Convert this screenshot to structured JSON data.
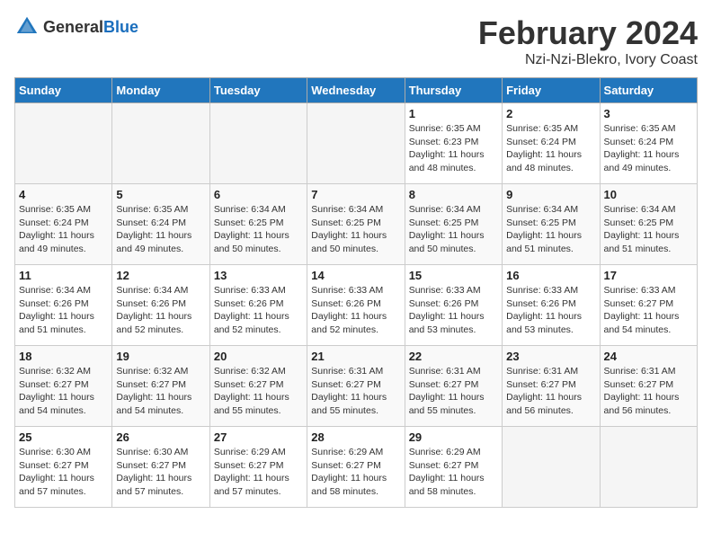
{
  "header": {
    "logo_general": "General",
    "logo_blue": "Blue",
    "month_title": "February 2024",
    "subtitle": "Nzi-Nzi-Blekro, Ivory Coast"
  },
  "days_of_week": [
    "Sunday",
    "Monday",
    "Tuesday",
    "Wednesday",
    "Thursday",
    "Friday",
    "Saturday"
  ],
  "weeks": [
    [
      {
        "day": "",
        "detail": ""
      },
      {
        "day": "",
        "detail": ""
      },
      {
        "day": "",
        "detail": ""
      },
      {
        "day": "",
        "detail": ""
      },
      {
        "day": "1",
        "detail": "Sunrise: 6:35 AM\nSunset: 6:23 PM\nDaylight: 11 hours\nand 48 minutes."
      },
      {
        "day": "2",
        "detail": "Sunrise: 6:35 AM\nSunset: 6:24 PM\nDaylight: 11 hours\nand 48 minutes."
      },
      {
        "day": "3",
        "detail": "Sunrise: 6:35 AM\nSunset: 6:24 PM\nDaylight: 11 hours\nand 49 minutes."
      }
    ],
    [
      {
        "day": "4",
        "detail": "Sunrise: 6:35 AM\nSunset: 6:24 PM\nDaylight: 11 hours\nand 49 minutes."
      },
      {
        "day": "5",
        "detail": "Sunrise: 6:35 AM\nSunset: 6:24 PM\nDaylight: 11 hours\nand 49 minutes."
      },
      {
        "day": "6",
        "detail": "Sunrise: 6:34 AM\nSunset: 6:25 PM\nDaylight: 11 hours\nand 50 minutes."
      },
      {
        "day": "7",
        "detail": "Sunrise: 6:34 AM\nSunset: 6:25 PM\nDaylight: 11 hours\nand 50 minutes."
      },
      {
        "day": "8",
        "detail": "Sunrise: 6:34 AM\nSunset: 6:25 PM\nDaylight: 11 hours\nand 50 minutes."
      },
      {
        "day": "9",
        "detail": "Sunrise: 6:34 AM\nSunset: 6:25 PM\nDaylight: 11 hours\nand 51 minutes."
      },
      {
        "day": "10",
        "detail": "Sunrise: 6:34 AM\nSunset: 6:25 PM\nDaylight: 11 hours\nand 51 minutes."
      }
    ],
    [
      {
        "day": "11",
        "detail": "Sunrise: 6:34 AM\nSunset: 6:26 PM\nDaylight: 11 hours\nand 51 minutes."
      },
      {
        "day": "12",
        "detail": "Sunrise: 6:34 AM\nSunset: 6:26 PM\nDaylight: 11 hours\nand 52 minutes."
      },
      {
        "day": "13",
        "detail": "Sunrise: 6:33 AM\nSunset: 6:26 PM\nDaylight: 11 hours\nand 52 minutes."
      },
      {
        "day": "14",
        "detail": "Sunrise: 6:33 AM\nSunset: 6:26 PM\nDaylight: 11 hours\nand 52 minutes."
      },
      {
        "day": "15",
        "detail": "Sunrise: 6:33 AM\nSunset: 6:26 PM\nDaylight: 11 hours\nand 53 minutes."
      },
      {
        "day": "16",
        "detail": "Sunrise: 6:33 AM\nSunset: 6:26 PM\nDaylight: 11 hours\nand 53 minutes."
      },
      {
        "day": "17",
        "detail": "Sunrise: 6:33 AM\nSunset: 6:27 PM\nDaylight: 11 hours\nand 54 minutes."
      }
    ],
    [
      {
        "day": "18",
        "detail": "Sunrise: 6:32 AM\nSunset: 6:27 PM\nDaylight: 11 hours\nand 54 minutes."
      },
      {
        "day": "19",
        "detail": "Sunrise: 6:32 AM\nSunset: 6:27 PM\nDaylight: 11 hours\nand 54 minutes."
      },
      {
        "day": "20",
        "detail": "Sunrise: 6:32 AM\nSunset: 6:27 PM\nDaylight: 11 hours\nand 55 minutes."
      },
      {
        "day": "21",
        "detail": "Sunrise: 6:31 AM\nSunset: 6:27 PM\nDaylight: 11 hours\nand 55 minutes."
      },
      {
        "day": "22",
        "detail": "Sunrise: 6:31 AM\nSunset: 6:27 PM\nDaylight: 11 hours\nand 55 minutes."
      },
      {
        "day": "23",
        "detail": "Sunrise: 6:31 AM\nSunset: 6:27 PM\nDaylight: 11 hours\nand 56 minutes."
      },
      {
        "day": "24",
        "detail": "Sunrise: 6:31 AM\nSunset: 6:27 PM\nDaylight: 11 hours\nand 56 minutes."
      }
    ],
    [
      {
        "day": "25",
        "detail": "Sunrise: 6:30 AM\nSunset: 6:27 PM\nDaylight: 11 hours\nand 57 minutes."
      },
      {
        "day": "26",
        "detail": "Sunrise: 6:30 AM\nSunset: 6:27 PM\nDaylight: 11 hours\nand 57 minutes."
      },
      {
        "day": "27",
        "detail": "Sunrise: 6:29 AM\nSunset: 6:27 PM\nDaylight: 11 hours\nand 57 minutes."
      },
      {
        "day": "28",
        "detail": "Sunrise: 6:29 AM\nSunset: 6:27 PM\nDaylight: 11 hours\nand 58 minutes."
      },
      {
        "day": "29",
        "detail": "Sunrise: 6:29 AM\nSunset: 6:27 PM\nDaylight: 11 hours\nand 58 minutes."
      },
      {
        "day": "",
        "detail": ""
      },
      {
        "day": "",
        "detail": ""
      }
    ]
  ]
}
